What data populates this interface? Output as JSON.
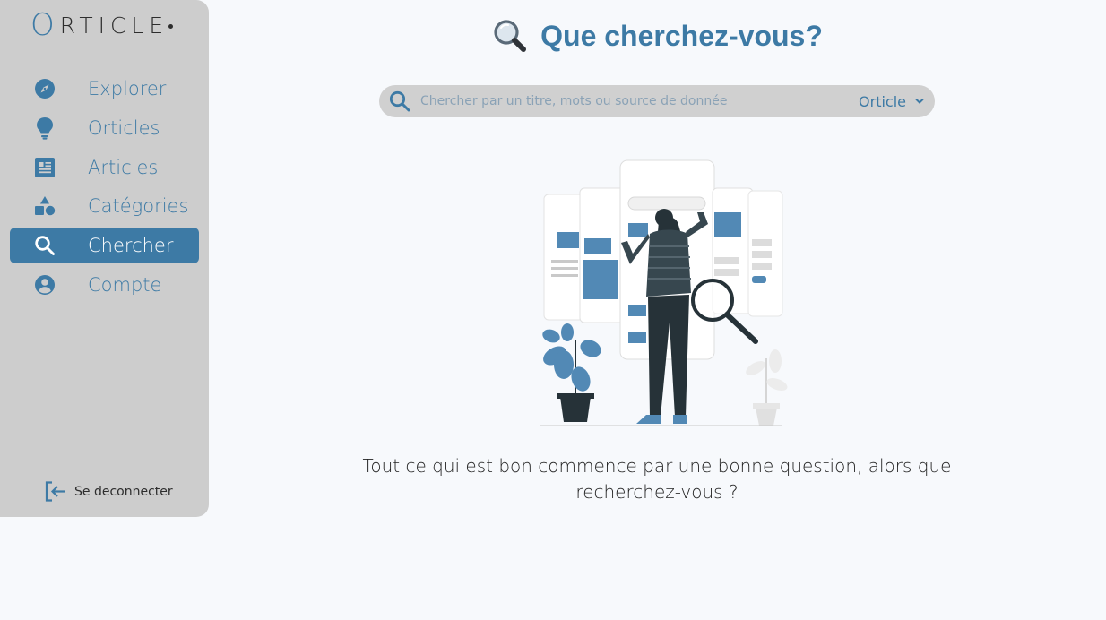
{
  "logo": {
    "first_letter": "O",
    "rest": "RTICLE"
  },
  "sidebar": {
    "items": [
      {
        "label": "Explorer",
        "icon": "compass-icon"
      },
      {
        "label": "Orticles",
        "icon": "lightbulb-icon"
      },
      {
        "label": "Articles",
        "icon": "newspaper-icon"
      },
      {
        "label": "Catégories",
        "icon": "shapes-icon"
      },
      {
        "label": "Chercher",
        "icon": "search-icon",
        "active": true
      },
      {
        "label": "Compte",
        "icon": "user-circle-icon"
      }
    ],
    "logout_label": "Se deconnecter"
  },
  "main": {
    "title": "Que cherchez-vous?",
    "search": {
      "placeholder": "Chercher par un titre, mots ou source de donnée",
      "value": "",
      "source_selected": "Orticle"
    },
    "caption": "Tout ce qui est bon commence par une bonne question, alors que recherchez-vous ?"
  },
  "colors": {
    "accent": "#3d7aa5",
    "sidebar_bg": "#cdcdcd",
    "page_bg": "#f7f9fc",
    "search_bg": "#d0d0d0"
  }
}
